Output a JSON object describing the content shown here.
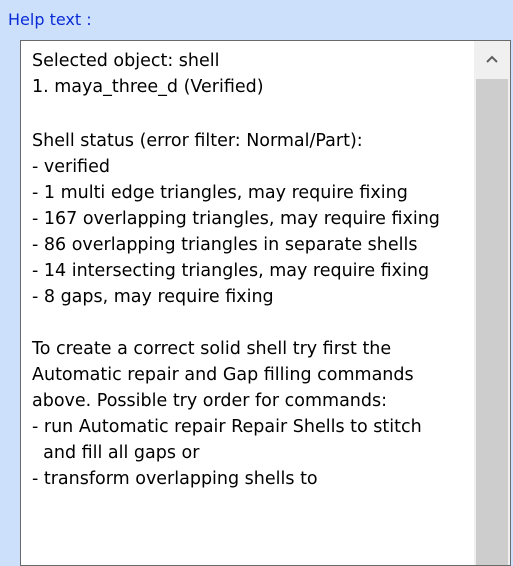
{
  "panel": {
    "title": "Help text :"
  },
  "help_text": {
    "lines": [
      "Selected object: shell",
      "1. maya_three_d (Verified)",
      "",
      "Shell status (error filter: Normal/Part):",
      "- verified",
      "- 1 multi edge triangles,  may require fixing",
      "- 167 overlapping triangles,  may require fixing",
      "- 86 overlapping triangles in separate shells",
      "- 14 intersecting triangles,  may require fixing",
      "- 8 gaps,  may require fixing",
      "",
      "To create a correct solid shell try first the",
      "Automatic repair and Gap filling commands",
      "above. Possible try order for commands:",
      "- run Automatic repair Repair Shells to stitch",
      "  and fill all gaps or",
      "- transform overlapping shells to"
    ]
  },
  "scrollbar": {
    "up_icon": "chevron-up-icon"
  }
}
